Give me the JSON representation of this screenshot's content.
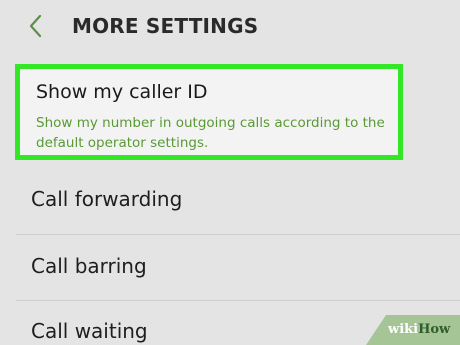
{
  "header": {
    "title": "MORE SETTINGS",
    "back_icon": "chevron-left-icon"
  },
  "highlighted_item": {
    "title": "Show my caller ID",
    "subtitle": "Show my number in outgoing calls according to the default operator settings.",
    "highlight_color": "#33e626",
    "subtitle_color": "#5a9a36"
  },
  "items": [
    {
      "label": "Call forwarding"
    },
    {
      "label": "Call barring"
    },
    {
      "label": "Call waiting"
    }
  ],
  "watermark": {
    "part1": "wiki",
    "part2": "How"
  }
}
